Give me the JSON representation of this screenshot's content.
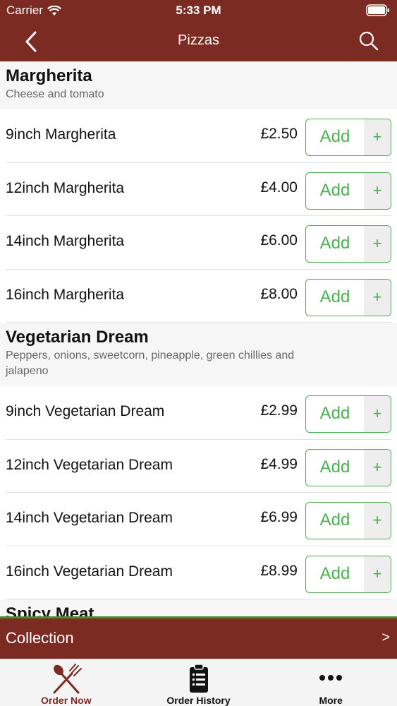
{
  "status_bar": {
    "carrier": "Carrier",
    "time": "5:33 PM"
  },
  "nav": {
    "title": "Pizzas"
  },
  "sections": [
    {
      "title": "Margherita",
      "description": "Cheese and tomato",
      "items": [
        {
          "name": "9inch Margherita",
          "price": "£2.50"
        },
        {
          "name": "12inch Margherita",
          "price": "£4.00"
        },
        {
          "name": "14inch Margherita",
          "price": "£6.00"
        },
        {
          "name": "16inch Margherita",
          "price": "£8.00"
        }
      ]
    },
    {
      "title": "Vegetarian Dream",
      "description": "Peppers, onions, sweetcorn, pineapple, green chillies and jalapeno",
      "items": [
        {
          "name": "9inch Vegetarian Dream",
          "price": "£2.99"
        },
        {
          "name": "12inch Vegetarian Dream",
          "price": "£4.99"
        },
        {
          "name": "14inch Vegetarian Dream",
          "price": "£6.99"
        },
        {
          "name": "16inch Vegetarian Dream",
          "price": "£8.99"
        }
      ]
    },
    {
      "title": "Spicy Meat",
      "description": "",
      "items": []
    }
  ],
  "buttons": {
    "add_label": "Add",
    "add_plus": "+"
  },
  "collection": {
    "label": "Collection",
    "chevron": ">"
  },
  "tabs": [
    {
      "label": "Order Now",
      "icon": "fork-spoon-icon",
      "active": true
    },
    {
      "label": "Order History",
      "icon": "clipboard-list-icon",
      "active": false
    },
    {
      "label": "More",
      "icon": "more-dots-icon",
      "active": false
    }
  ],
  "colors": {
    "brand": "#7b2b22",
    "accent_green": "#4caf4f",
    "tab_active": "#7b2b22",
    "tab_inactive": "#111111"
  }
}
